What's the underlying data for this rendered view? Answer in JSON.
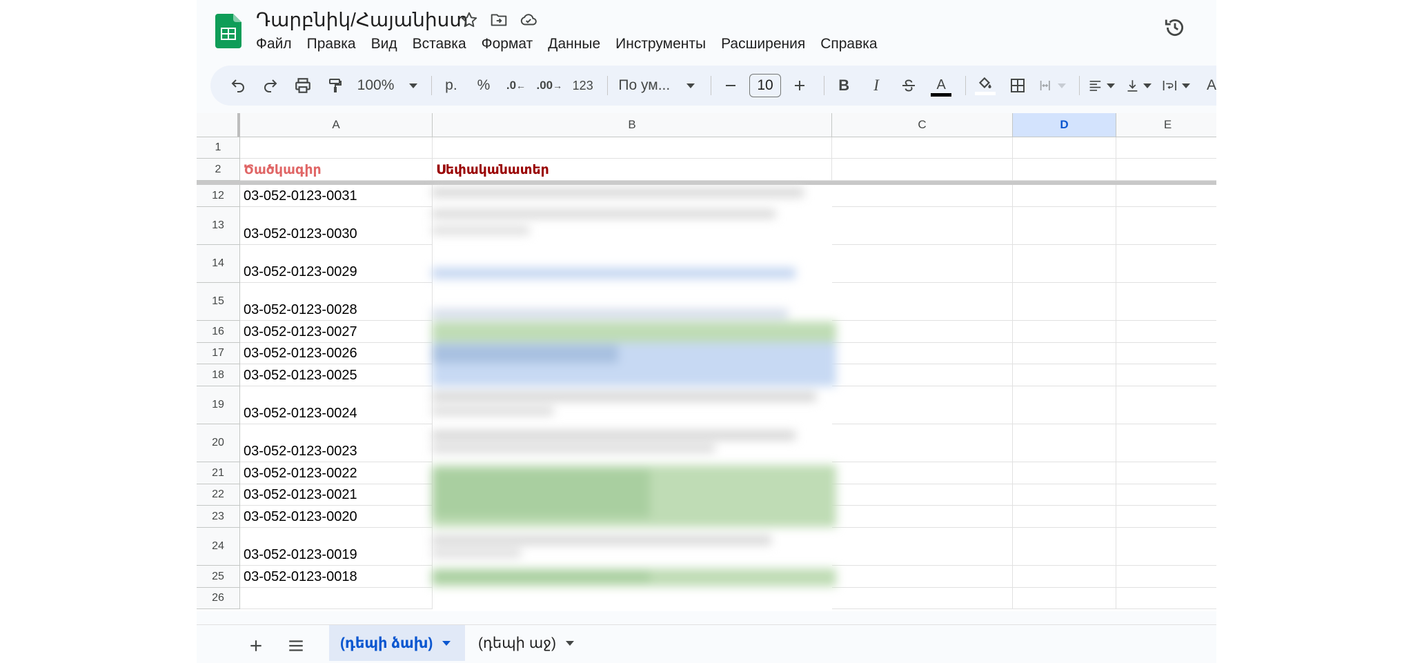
{
  "document": {
    "title": "Դարբնիկ/Հայանիստ"
  },
  "menu": [
    "Файл",
    "Правка",
    "Вид",
    "Вставка",
    "Формат",
    "Данные",
    "Инструменты",
    "Расширения",
    "Справка"
  ],
  "toolbar": {
    "zoom": "100%",
    "currency": "р.",
    "percent": "%",
    "decrease_decimals": ".0",
    "increase_decimals": ".00",
    "number_format": "123",
    "font": "По ум...",
    "font_size": "10",
    "text_color": "#000000"
  },
  "columns": [
    "A",
    "B",
    "C",
    "D",
    "E"
  ],
  "selected_column": "D",
  "rows": [
    {
      "num": "1",
      "a": "",
      "b": ""
    },
    {
      "num": "2",
      "a": "Ծածկագիր",
      "b": "Սեփականատեր"
    },
    {
      "num": "12",
      "a": "03-052-0123-0031",
      "b": ""
    },
    {
      "num": "13",
      "a": "03-052-0123-0030",
      "b": ""
    },
    {
      "num": "14",
      "a": "03-052-0123-0029",
      "b": ""
    },
    {
      "num": "15",
      "a": "03-052-0123-0028",
      "b": ""
    },
    {
      "num": "16",
      "a": "03-052-0123-0027",
      "b": ""
    },
    {
      "num": "17",
      "a": "03-052-0123-0026",
      "b": ""
    },
    {
      "num": "18",
      "a": "03-052-0123-0025",
      "b": ""
    },
    {
      "num": "19",
      "a": "03-052-0123-0024",
      "b": ""
    },
    {
      "num": "20",
      "a": "03-052-0123-0023",
      "b": ""
    },
    {
      "num": "21",
      "a": "03-052-0123-0022",
      "b": ""
    },
    {
      "num": "22",
      "a": "03-052-0123-0021",
      "b": ""
    },
    {
      "num": "23",
      "a": "03-052-0123-0020",
      "b": ""
    },
    {
      "num": "24",
      "a": "03-052-0123-0019",
      "b": ""
    },
    {
      "num": "25",
      "a": "03-052-0123-0018",
      "b": ""
    },
    {
      "num": "26",
      "a": "",
      "b": ""
    }
  ],
  "sheets": [
    {
      "label": "(դեպի ձախ)",
      "active": true
    },
    {
      "label": "(դեպի աջ)",
      "active": false
    }
  ],
  "colors": {
    "header_code": "#e06666",
    "header_owner": "#990000",
    "selected_column_bg": "#d3e3fd",
    "active_tab": "#0b57d0"
  }
}
